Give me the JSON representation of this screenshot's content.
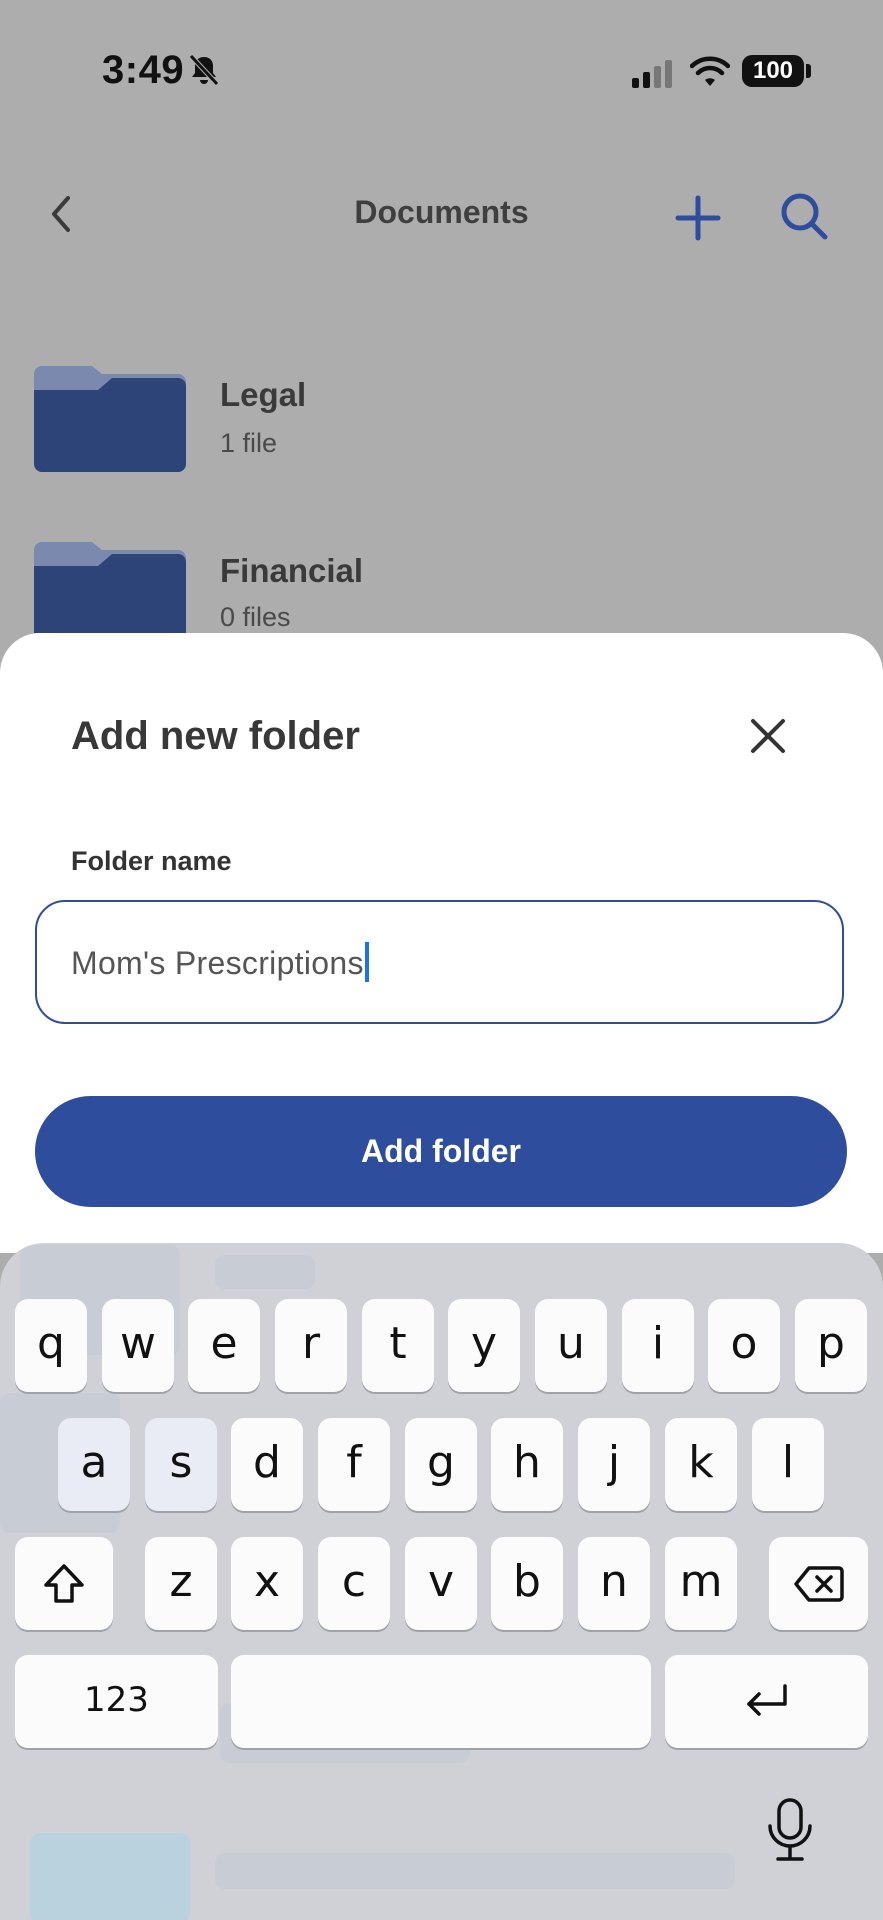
{
  "status_bar": {
    "time": "3:49",
    "battery": "100"
  },
  "header": {
    "title": "Documents"
  },
  "folders": [
    {
      "name": "Legal",
      "count": "1 file"
    },
    {
      "name": "Financial",
      "count": "0 files"
    }
  ],
  "sheet": {
    "title": "Add new folder",
    "field_label": "Folder name",
    "field_value": "Mom's Prescriptions",
    "submit_label": "Add folder"
  },
  "keyboard": {
    "row1": [
      "q",
      "w",
      "e",
      "r",
      "t",
      "y",
      "u",
      "i",
      "o",
      "p"
    ],
    "row2": [
      "a",
      "s",
      "d",
      "f",
      "g",
      "h",
      "j",
      "k",
      "l"
    ],
    "row3": [
      "z",
      "x",
      "c",
      "v",
      "b",
      "n",
      "m"
    ],
    "numbers_label": "123"
  },
  "colors": {
    "accent": "#2e4d9c",
    "overlay": "#adadad",
    "folder_dark": "#2d4478",
    "folder_light": "#7a89ad"
  }
}
